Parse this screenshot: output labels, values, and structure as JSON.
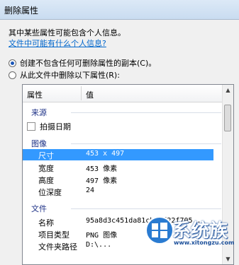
{
  "window": {
    "title": "删除属性"
  },
  "intro": "其中某些属性可能包含个人信息。",
  "link": "文件中可能有什么个人信息?",
  "options": [
    {
      "label": "创建不包含任何可删除属性的副本(C)。",
      "checked": true
    },
    {
      "label": "从此文件中删除以下属性(R):",
      "checked": false
    }
  ],
  "table": {
    "headers": {
      "property": "属性",
      "value": "值"
    },
    "groups": {
      "origin": "来源",
      "image": "图像",
      "file": "文件"
    },
    "origin_items": [
      {
        "label": "拍摄日期",
        "checked": false
      }
    ],
    "image_rows": [
      {
        "k": "尺寸",
        "v": "453 x 497",
        "selected": true
      },
      {
        "k": "宽度",
        "v": "453 像素"
      },
      {
        "k": "高度",
        "v": "497 像素"
      },
      {
        "k": "位深度",
        "v": "24"
      }
    ],
    "file_rows": [
      {
        "k": "名称",
        "v": "95a8d3c451da81cbccf22f705..."
      },
      {
        "k": "项目类型",
        "v": "PNG 图像"
      },
      {
        "k": "文件夹路径",
        "v": "D:\\..."
      }
    ]
  },
  "watermark": {
    "brand": "系统族",
    "url": "www.xitongzu.com"
  },
  "colors": {
    "selection": "#3399ff",
    "link": "#0066cc",
    "group": "#1e3287"
  }
}
